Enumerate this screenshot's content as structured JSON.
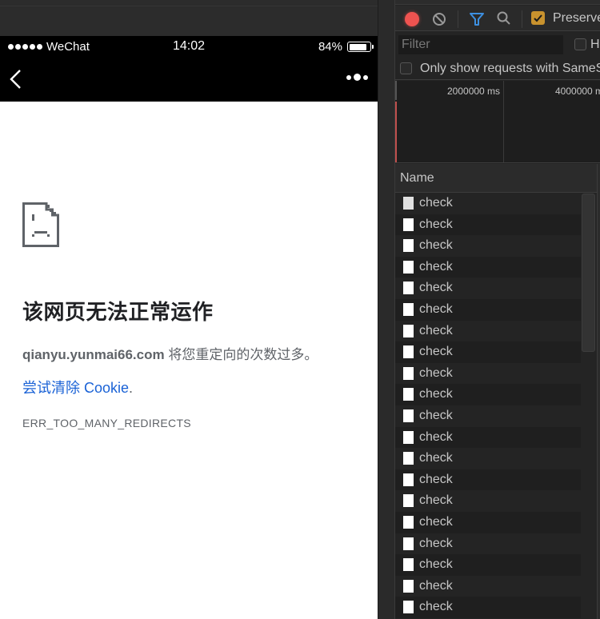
{
  "phone": {
    "statusbar": {
      "carrier": "WeChat",
      "time": "14:02",
      "battery_percent_label": "84%",
      "battery_level": 0.84
    },
    "navbar": {
      "back_icon": "chevron-left-icon",
      "more_icon": "more-dots-icon"
    },
    "error_page": {
      "icon": "sad-document-icon",
      "title": "该网页无法正常运作",
      "host": "qianyu.yunmai66.com",
      "description_suffix": " 将您重定向的次数过多。",
      "link_label": "尝试清除 Cookie",
      "link_suffix": ".",
      "error_code": "ERR_TOO_MANY_REDIRECTS"
    }
  },
  "devtools": {
    "toolbar": {
      "record_icon": "record-icon",
      "clear_icon": "clear-icon",
      "filter_icon": "filter-icon",
      "search_icon": "search-icon",
      "preserve_log_label": "Preserve",
      "preserve_log_checked": true
    },
    "filter": {
      "placeholder": "Filter",
      "value": "",
      "hide_data_label": "H",
      "hide_data_checked": false
    },
    "samesite": {
      "label": "Only show requests with SameSit",
      "checked": false
    },
    "overview": {
      "ticks": [
        "2000000 ms",
        "4000000 m"
      ]
    },
    "table": {
      "column_name": "Name",
      "rows": [
        {
          "name": "check"
        },
        {
          "name": "check"
        },
        {
          "name": "check"
        },
        {
          "name": "check"
        },
        {
          "name": "check"
        },
        {
          "name": "check"
        },
        {
          "name": "check"
        },
        {
          "name": "check"
        },
        {
          "name": "check"
        },
        {
          "name": "check"
        },
        {
          "name": "check"
        },
        {
          "name": "check"
        },
        {
          "name": "check"
        },
        {
          "name": "check"
        },
        {
          "name": "check"
        },
        {
          "name": "check"
        },
        {
          "name": "check"
        },
        {
          "name": "check"
        },
        {
          "name": "check"
        },
        {
          "name": "check"
        }
      ]
    }
  }
}
